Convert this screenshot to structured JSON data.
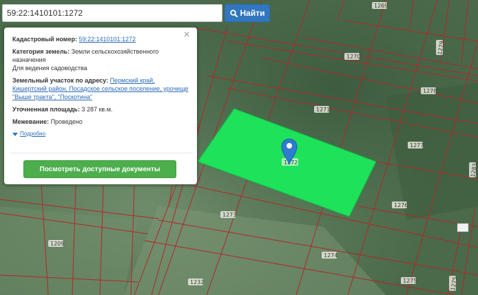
{
  "search": {
    "value": "59:22:1410101:1272",
    "button_label": "Найти"
  },
  "popup": {
    "cadastral_label": "Кадастровый номер:",
    "cadastral_value": "59:22:1410101:1272",
    "category_label": "Категория земель:",
    "category_value": "Земли сельскохозяйственного назначения",
    "usage_value": "Для ведения садоводства",
    "address_label": "Земельный участок по адресу:",
    "address_value": "Пермский край, Кишертский район, Посадское сельское поселение, урочище \"Выше тракта\", \"Поскотина\"",
    "area_label": "Уточненная площадь:",
    "area_value": "3 287 кв.м.",
    "survey_label": "Межевание:",
    "survey_value": "Проведено",
    "more_label": "Подробно",
    "docs_button": "Посмотреть доступные документы"
  },
  "map": {
    "selected_plot_label": "1272",
    "plot_labels": [
      "1269",
      "1270",
      "1279",
      "1278",
      "1271",
      "1277",
      "1276",
      "1273",
      "1274",
      "1275",
      "1209",
      "1232",
      "1283"
    ],
    "colors": {
      "boundary": "#b3262a",
      "selected_fill": "#1ee25a",
      "marker": "#2f7bd0"
    }
  }
}
